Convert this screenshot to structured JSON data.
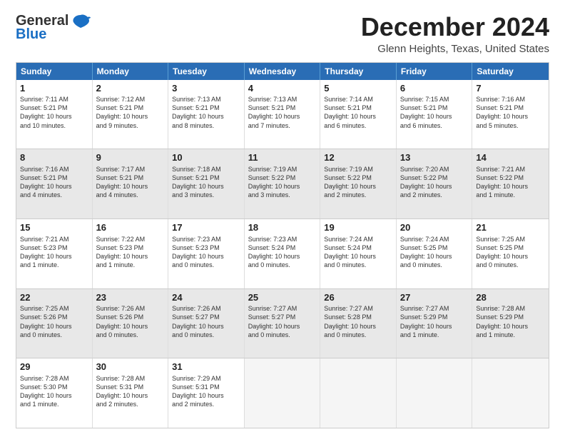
{
  "logo": {
    "line1": "General",
    "line2": "Blue"
  },
  "title": "December 2024",
  "subtitle": "Glenn Heights, Texas, United States",
  "headers": [
    "Sunday",
    "Monday",
    "Tuesday",
    "Wednesday",
    "Thursday",
    "Friday",
    "Saturday"
  ],
  "rows": [
    [
      {
        "num": "",
        "info": "",
        "empty": true
      },
      {
        "num": "2",
        "info": "Sunrise: 7:12 AM\nSunset: 5:21 PM\nDaylight: 10 hours\nand 9 minutes."
      },
      {
        "num": "3",
        "info": "Sunrise: 7:13 AM\nSunset: 5:21 PM\nDaylight: 10 hours\nand 8 minutes."
      },
      {
        "num": "4",
        "info": "Sunrise: 7:13 AM\nSunset: 5:21 PM\nDaylight: 10 hours\nand 7 minutes."
      },
      {
        "num": "5",
        "info": "Sunrise: 7:14 AM\nSunset: 5:21 PM\nDaylight: 10 hours\nand 6 minutes."
      },
      {
        "num": "6",
        "info": "Sunrise: 7:15 AM\nSunset: 5:21 PM\nDaylight: 10 hours\nand 6 minutes."
      },
      {
        "num": "7",
        "info": "Sunrise: 7:16 AM\nSunset: 5:21 PM\nDaylight: 10 hours\nand 5 minutes."
      }
    ],
    [
      {
        "num": "1",
        "info": "Sunrise: 7:11 AM\nSunset: 5:21 PM\nDaylight: 10 hours\nand 10 minutes.",
        "shaded": true
      },
      {
        "num": "",
        "info": "",
        "empty": true,
        "shaded": true
      },
      {
        "num": "",
        "info": "",
        "empty": true,
        "shaded": true
      },
      {
        "num": "",
        "info": "",
        "empty": true,
        "shaded": true
      },
      {
        "num": "",
        "info": "",
        "empty": true,
        "shaded": true
      },
      {
        "num": "",
        "info": "",
        "empty": true,
        "shaded": true
      },
      {
        "num": "",
        "info": "",
        "empty": true,
        "shaded": true
      }
    ],
    [
      {
        "num": "8",
        "info": "Sunrise: 7:16 AM\nSunset: 5:21 PM\nDaylight: 10 hours\nand 4 minutes.",
        "shaded": true
      },
      {
        "num": "9",
        "info": "Sunrise: 7:17 AM\nSunset: 5:21 PM\nDaylight: 10 hours\nand 4 minutes.",
        "shaded": true
      },
      {
        "num": "10",
        "info": "Sunrise: 7:18 AM\nSunset: 5:21 PM\nDaylight: 10 hours\nand 3 minutes.",
        "shaded": true
      },
      {
        "num": "11",
        "info": "Sunrise: 7:19 AM\nSunset: 5:22 PM\nDaylight: 10 hours\nand 3 minutes.",
        "shaded": true
      },
      {
        "num": "12",
        "info": "Sunrise: 7:19 AM\nSunset: 5:22 PM\nDaylight: 10 hours\nand 2 minutes.",
        "shaded": true
      },
      {
        "num": "13",
        "info": "Sunrise: 7:20 AM\nSunset: 5:22 PM\nDaylight: 10 hours\nand 2 minutes.",
        "shaded": true
      },
      {
        "num": "14",
        "info": "Sunrise: 7:21 AM\nSunset: 5:22 PM\nDaylight: 10 hours\nand 1 minute.",
        "shaded": true
      }
    ],
    [
      {
        "num": "15",
        "info": "Sunrise: 7:21 AM\nSunset: 5:23 PM\nDaylight: 10 hours\nand 1 minute."
      },
      {
        "num": "16",
        "info": "Sunrise: 7:22 AM\nSunset: 5:23 PM\nDaylight: 10 hours\nand 1 minute."
      },
      {
        "num": "17",
        "info": "Sunrise: 7:23 AM\nSunset: 5:23 PM\nDaylight: 10 hours\nand 0 minutes."
      },
      {
        "num": "18",
        "info": "Sunrise: 7:23 AM\nSunset: 5:24 PM\nDaylight: 10 hours\nand 0 minutes."
      },
      {
        "num": "19",
        "info": "Sunrise: 7:24 AM\nSunset: 5:24 PM\nDaylight: 10 hours\nand 0 minutes."
      },
      {
        "num": "20",
        "info": "Sunrise: 7:24 AM\nSunset: 5:25 PM\nDaylight: 10 hours\nand 0 minutes."
      },
      {
        "num": "21",
        "info": "Sunrise: 7:25 AM\nSunset: 5:25 PM\nDaylight: 10 hours\nand 0 minutes."
      }
    ],
    [
      {
        "num": "22",
        "info": "Sunrise: 7:25 AM\nSunset: 5:26 PM\nDaylight: 10 hours\nand 0 minutes.",
        "shaded": true
      },
      {
        "num": "23",
        "info": "Sunrise: 7:26 AM\nSunset: 5:26 PM\nDaylight: 10 hours\nand 0 minutes.",
        "shaded": true
      },
      {
        "num": "24",
        "info": "Sunrise: 7:26 AM\nSunset: 5:27 PM\nDaylight: 10 hours\nand 0 minutes.",
        "shaded": true
      },
      {
        "num": "25",
        "info": "Sunrise: 7:27 AM\nSunset: 5:27 PM\nDaylight: 10 hours\nand 0 minutes.",
        "shaded": true
      },
      {
        "num": "26",
        "info": "Sunrise: 7:27 AM\nSunset: 5:28 PM\nDaylight: 10 hours\nand 0 minutes.",
        "shaded": true
      },
      {
        "num": "27",
        "info": "Sunrise: 7:27 AM\nSunset: 5:29 PM\nDaylight: 10 hours\nand 1 minute.",
        "shaded": true
      },
      {
        "num": "28",
        "info": "Sunrise: 7:28 AM\nSunset: 5:29 PM\nDaylight: 10 hours\nand 1 minute.",
        "shaded": true
      }
    ],
    [
      {
        "num": "29",
        "info": "Sunrise: 7:28 AM\nSunset: 5:30 PM\nDaylight: 10 hours\nand 1 minute."
      },
      {
        "num": "30",
        "info": "Sunrise: 7:28 AM\nSunset: 5:31 PM\nDaylight: 10 hours\nand 2 minutes."
      },
      {
        "num": "31",
        "info": "Sunrise: 7:29 AM\nSunset: 5:31 PM\nDaylight: 10 hours\nand 2 minutes."
      },
      {
        "num": "",
        "info": "",
        "empty": true
      },
      {
        "num": "",
        "info": "",
        "empty": true
      },
      {
        "num": "",
        "info": "",
        "empty": true
      },
      {
        "num": "",
        "info": "",
        "empty": true
      }
    ]
  ]
}
